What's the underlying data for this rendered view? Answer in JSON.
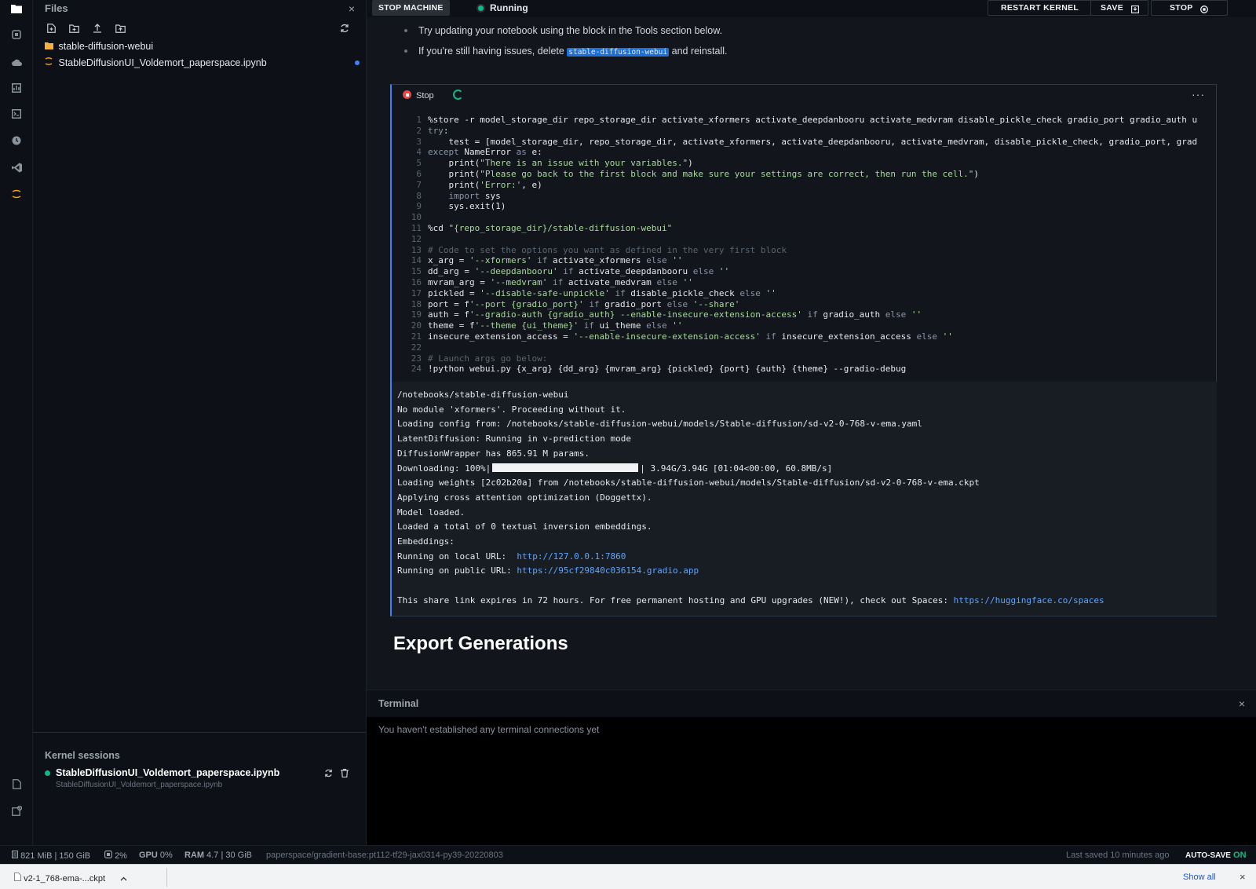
{
  "rail": {
    "icons": [
      "folder-icon",
      "cpu-icon",
      "cloud-icon",
      "chart-icon",
      "terminal-icon",
      "history-icon",
      "vscode-icon",
      "jupyter-icon",
      "notebook-info-icon",
      "settings-icon"
    ]
  },
  "files": {
    "title": "Files",
    "close": "×",
    "items": [
      {
        "name": "stable-diffusion-webui",
        "type": "folder",
        "icon": "folder-icon"
      },
      {
        "name": "StableDiffusionUI_Voldemort_paperspace.ipynb",
        "type": "notebook",
        "icon": "jupyter-file-icon"
      }
    ]
  },
  "kernel_sessions": {
    "title": "Kernel sessions",
    "name": "StableDiffusionUI_Voldemort_paperspace.ipynb",
    "sub": "StableDiffusionUI_Voldemort_paperspace.ipynb"
  },
  "topbar": {
    "stop_machine": "STOP MACHINE",
    "status": "Running",
    "restart_kernel": "RESTART KERNEL",
    "save": "SAVE",
    "stop": "STOP"
  },
  "bullets": {
    "b1": "Try updating your notebook using the block in the Tools section below.",
    "b2_pre": "If you're still having issues, delete ",
    "b2_code": "stable-diffusion-webui",
    "b2_post": " and reinstall."
  },
  "cell": {
    "stop_label": "Stop",
    "more": "···",
    "lines": [
      "%store -r model_storage_dir repo_storage_dir activate_xformers activate_deepdanbooru activate_medvram disable_pickle_check gradio_port gradio_auth u",
      "try:",
      "    test = [model_storage_dir, repo_storage_dir, activate_xformers, activate_deepdanbooru, activate_medvram, disable_pickle_check, gradio_port, grad",
      "except NameError as e:",
      "    print(\"There is an issue with your variables.\")",
      "    print(\"Please go back to the first block and make sure your settings are correct, then run the cell.\")",
      "    print('Error:', e)",
      "    import sys",
      "    sys.exit(1)",
      "",
      "%cd \"{repo_storage_dir}/stable-diffusion-webui\"",
      "",
      "# Code to set the options you want as defined in the very first block",
      "x_arg = '--xformers' if activate_xformers else ''",
      "dd_arg = '--deepdanbooru' if activate_deepdanbooru else ''",
      "mvram_arg = '--medvram' if activate_medvram else ''",
      "pickled = '--disable-safe-unpickle' if disable_pickle_check else ''",
      "port = f'--port {gradio_port}' if gradio_port else '--share'",
      "auth = f'--gradio-auth {gradio_auth} --enable-insecure-extension-access' if gradio_auth else ''",
      "theme = f'--theme {ui_theme}' if ui_theme else ''",
      "insecure_extension_access = '--enable-insecure-extension-access' if insecure_extension_access else ''",
      "",
      "# Launch args go below:",
      "!python webui.py {x_arg} {dd_arg} {mvram_arg} {pickled} {port} {auth} {theme} --gradio-debug"
    ],
    "output": {
      "l1": "/notebooks/stable-diffusion-webui",
      "l2": "No module 'xformers'. Proceeding without it.",
      "l3": "Loading config from: /notebooks/stable-diffusion-webui/models/Stable-diffusion/sd-v2-0-768-v-ema.yaml",
      "l4": "LatentDiffusion: Running in v-prediction mode",
      "l5": "DiffusionWrapper has 865.91 M params.",
      "l6_pre": "Downloading: 100%|",
      "l6_post": "| 3.94G/3.94G [01:04<00:00, 60.8MB/s]",
      "l7": "Loading weights [2c02b20a] from /notebooks/stable-diffusion-webui/models/Stable-diffusion/sd-v2-0-768-v-ema.ckpt",
      "l8": "Applying cross attention optimization (Doggettx).",
      "l9": "Model loaded.",
      "l10": "Loaded a total of 0 textual inversion embeddings.",
      "l11": "Embeddings:",
      "l12_pre": "Running on local URL:  ",
      "l12_link": "http://127.0.0.1:7860",
      "l13_pre": "Running on public URL: ",
      "l13_link": "https://95cf29840c036154.gradio.app",
      "l14_pre": "This share link expires in 72 hours. For free permanent hosting and GPU upgrades (NEW!), check out Spaces: ",
      "l14_link": "https://huggingface.co/spaces"
    }
  },
  "export_heading": "Export Generations",
  "terminal": {
    "title": "Terminal",
    "close": "×",
    "message": "You haven't established any terminal connections yet"
  },
  "status": {
    "storage": "821 MiB | 150 GiB",
    "cpu": "2%",
    "gpu_label": "GPU",
    "gpu": "0%",
    "ram_label": "RAM",
    "ram": "4.7 | 30 GiB",
    "image": "paperspace/gradient-base:pt112-tf29-jax0314-py39-20220803",
    "last_saved": "Last saved 10 minutes ago",
    "autosave_label": "AUTO-SAVE",
    "autosave_state": "ON"
  },
  "downloads": {
    "file": "v2-1_768-ema-...ckpt",
    "show_all": "Show all",
    "close": "×"
  },
  "colors": {
    "accent": "#3b82f6",
    "running": "#10b981",
    "stop": "#ef4444"
  }
}
